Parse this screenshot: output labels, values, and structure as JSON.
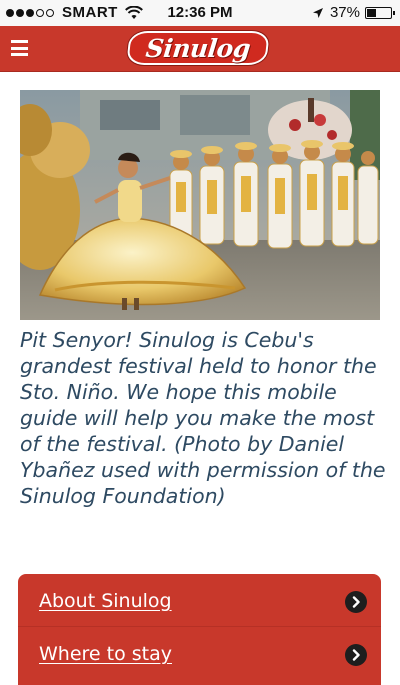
{
  "status_bar": {
    "carrier": "SMART",
    "time": "12:36 PM",
    "battery": "37%",
    "battery_level": 0.37
  },
  "header": {
    "logo_text": "Sinulog",
    "accent_color": "#c8382b"
  },
  "hero": {
    "icon": "festival-photo"
  },
  "intro": {
    "text": "Pit Senyor! Sinulog is Cebu's grandest festival held to honor the Sto. Niño. We hope this mobile guide will help you make the most of the festival. (Photo by Daniel Ybañez used with permission of the Sinulog Foundation)"
  },
  "nav": {
    "items": [
      {
        "label": "About Sinulog",
        "icon": "chevron-right-icon"
      },
      {
        "label": "Where to stay",
        "icon": "chevron-right-icon"
      }
    ]
  }
}
